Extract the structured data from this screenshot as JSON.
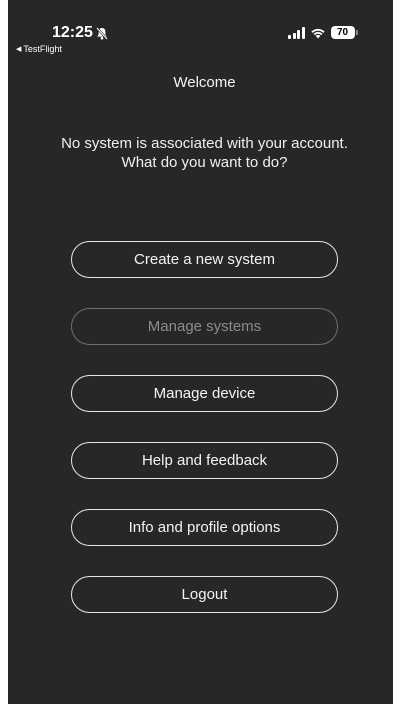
{
  "status_bar": {
    "time": "12:25",
    "back_app": "TestFlight",
    "battery": "70"
  },
  "title": "Welcome",
  "message": {
    "line1": "No system is associated with your account.",
    "line2": "What do you want to do?"
  },
  "buttons": {
    "create_system": "Create a new system",
    "manage_systems": "Manage systems",
    "manage_device": "Manage device",
    "help_feedback": "Help and feedback",
    "info_profile": "Info and profile options",
    "logout": "Logout"
  },
  "icons": {
    "silent_mode": "bell-slash-icon",
    "back": "back-triangle-icon",
    "signal": "cellular-signal-icon",
    "wifi": "wifi-icon",
    "battery": "battery-icon"
  },
  "colors": {
    "background": "#272727",
    "text": "#f4f4f4",
    "button_border": "#e6e6e6",
    "disabled": "#8c8c8c"
  }
}
